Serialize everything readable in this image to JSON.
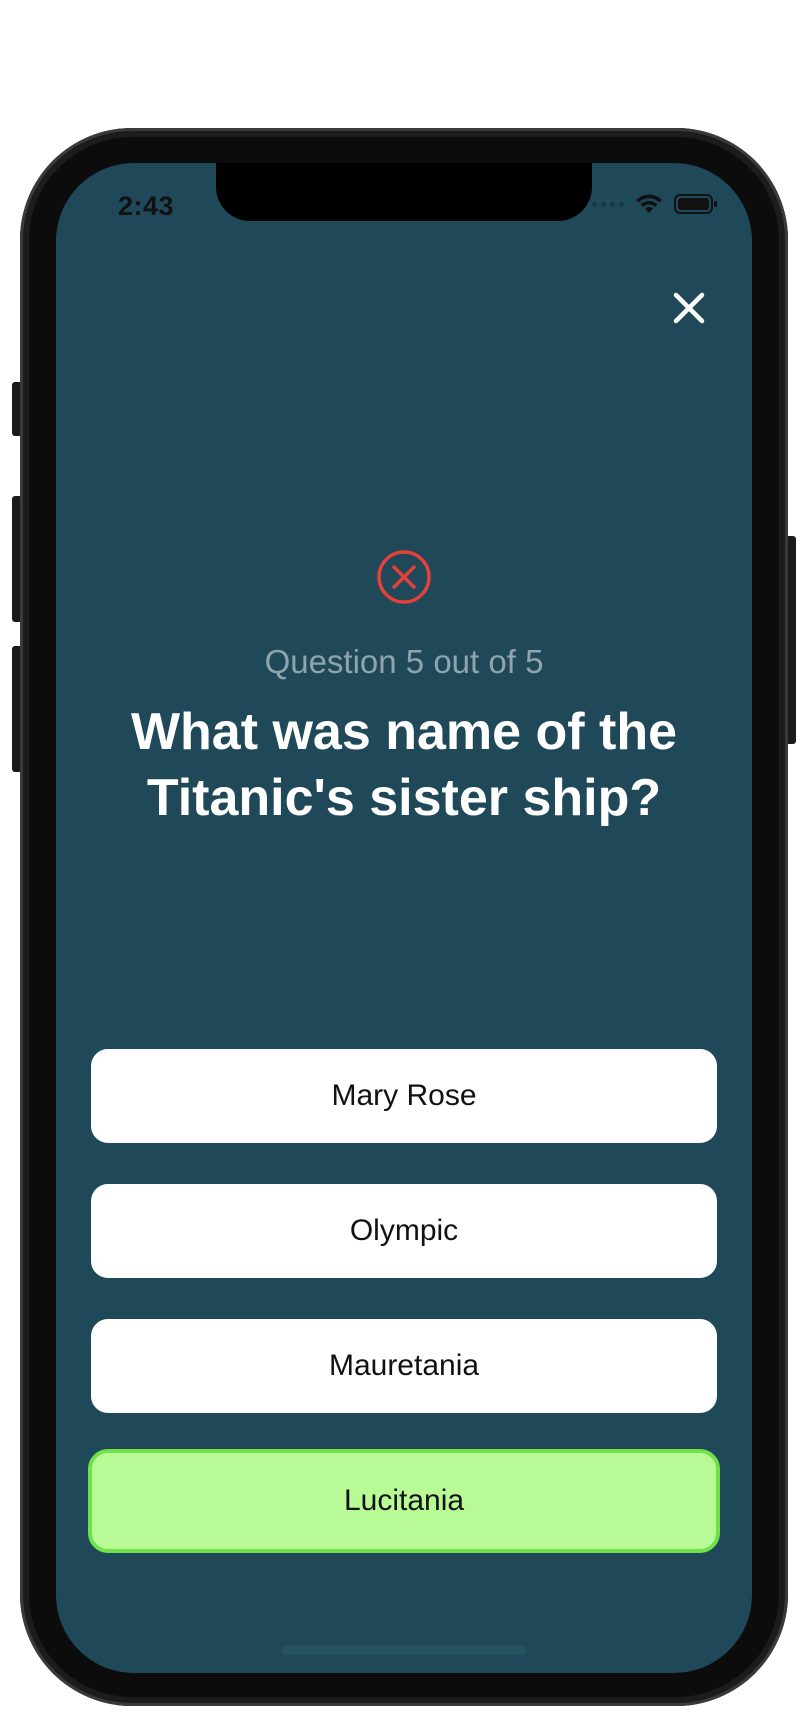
{
  "status_bar": {
    "time": "2:43"
  },
  "quiz": {
    "counter": "Question 5 out of 5",
    "question": "What was name of the Titanic's sister ship?",
    "result": "incorrect",
    "answers": [
      {
        "label": "Mary Rose",
        "state": "default"
      },
      {
        "label": "Olympic",
        "state": "default"
      },
      {
        "label": "Mauretania",
        "state": "default"
      },
      {
        "label": "Lucitania",
        "state": "correct"
      }
    ]
  },
  "colors": {
    "background": "#1f4858",
    "answer_default": "#ffffff",
    "answer_correct_fill": "#b8fa96",
    "answer_correct_border": "#6fe24b",
    "result_incorrect": "#e5413a",
    "counter_text": "#8fa4ad"
  },
  "icons": {
    "close": "close-icon",
    "result": "x-circle-icon",
    "wifi": "wifi-icon",
    "battery": "battery-icon"
  }
}
